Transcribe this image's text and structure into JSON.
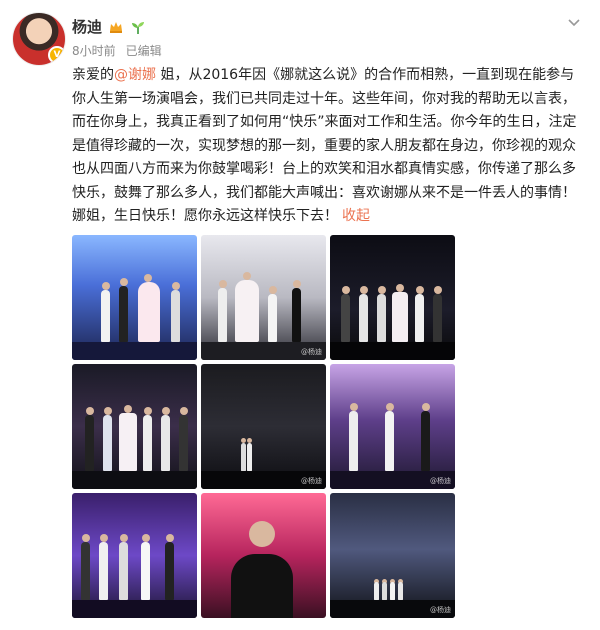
{
  "post": {
    "author": "杨迪",
    "time": "8小时前",
    "edited": "已编辑",
    "text_before": "亲爱的",
    "mention": "@谢娜",
    "text_after": " 姐，从2016年因《娜就这么说》的合作而相熟，一直到现在能参与你人生第一场演唱会，我们已共同走过十年。这些年间，你对我的帮助无以言表，而在你身上，我真正看到了如何用“快乐”来面对工作和生活。你今年的生日，注定是值得珍藏的一次，实现梦想的那一刻，重要的家人朋友都在身边，你珍视的观众也从四面八方而来为你鼓掌喝彩！台上的欢笑和泪水都真情实感，你传递了那么多快乐，鼓舞了那么多人，我们都能大声喊出：喜欢谢娜从来不是一件丢人的事情！娜姐，生日快乐！愿你永远这样快乐下去！",
    "collapse": "收起"
  },
  "images": {
    "watermark": "@杨迪"
  },
  "colors": {
    "link": "#eb7350",
    "meta": "#8a8a8a",
    "badge": "#f7b500"
  },
  "icons": {
    "crown": "crown-icon",
    "sprout": "sprout-icon",
    "chevron": "chevron-down-icon",
    "verified": "verified-icon"
  }
}
